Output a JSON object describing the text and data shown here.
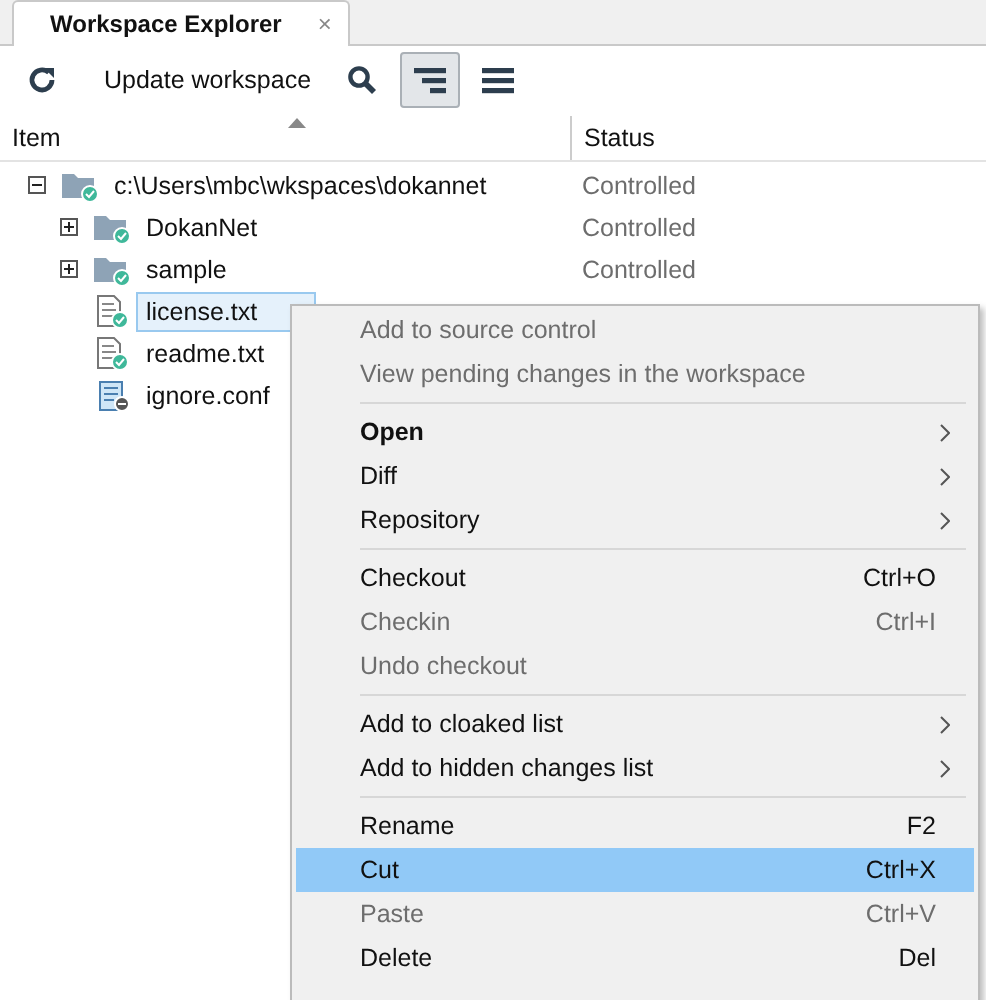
{
  "tabs": [
    {
      "label": "Workspace Explorer",
      "close": "×",
      "selected": true
    }
  ],
  "toolbar": {
    "items": [
      {
        "kind": "refresh",
        "selected": false
      },
      {
        "kind": "label",
        "label": "Update workspace"
      },
      {
        "kind": "search",
        "selected": false
      },
      {
        "kind": "filter",
        "selected": true
      },
      {
        "kind": "menu",
        "selected": false
      }
    ]
  },
  "table": {
    "columns": [
      {
        "label": "Item",
        "sorted": true
      },
      {
        "label": "Status"
      }
    ],
    "rows": [
      {
        "name": "c:\\Users\\mbc\\wkspaces\\dokannet",
        "kind": "folder",
        "status": "Controlled",
        "expanded": true,
        "selected": false,
        "children": [
          {
            "name": "DokanNet",
            "kind": "folder",
            "status": "Controlled",
            "expanded": false,
            "selected": false
          },
          {
            "name": "sample",
            "kind": "folder",
            "status": "Controlled",
            "expanded": false,
            "selected": false
          },
          {
            "name": "license.txt",
            "kind": "file",
            "selected": true
          },
          {
            "name": "readme.txt",
            "kind": "file",
            "selected": false
          },
          {
            "name": "ignore.conf",
            "kind": "config",
            "selected": false
          }
        ]
      }
    ]
  },
  "context_menu": {
    "items": [
      {
        "kind": "item",
        "label": "Add to source control",
        "disabled": true,
        "bold": false,
        "submenu": false,
        "selected": false
      },
      {
        "kind": "item",
        "label": "View pending changes in the workspace",
        "disabled": true,
        "bold": false,
        "submenu": false,
        "selected": false
      },
      {
        "kind": "separator"
      },
      {
        "kind": "item",
        "label": "Open",
        "disabled": false,
        "bold": true,
        "submenu": true,
        "selected": false
      },
      {
        "kind": "item",
        "label": "Diff",
        "disabled": false,
        "bold": false,
        "submenu": true,
        "selected": false
      },
      {
        "kind": "item",
        "label": "Repository",
        "disabled": false,
        "bold": false,
        "submenu": true,
        "selected": false
      },
      {
        "kind": "separator"
      },
      {
        "kind": "item",
        "label": "Checkout",
        "shortcut": "Ctrl+O",
        "disabled": false,
        "bold": false,
        "submenu": false,
        "selected": false
      },
      {
        "kind": "item",
        "label": "Checkin",
        "shortcut": "Ctrl+I",
        "disabled": true,
        "bold": false,
        "submenu": false,
        "selected": false
      },
      {
        "kind": "item",
        "label": "Undo checkout",
        "disabled": true,
        "bold": false,
        "submenu": false,
        "selected": false
      },
      {
        "kind": "separator"
      },
      {
        "kind": "item",
        "label": "Add to cloaked list",
        "disabled": false,
        "bold": false,
        "submenu": true,
        "selected": false
      },
      {
        "kind": "item",
        "label": "Add to hidden changes list",
        "disabled": false,
        "bold": false,
        "submenu": true,
        "selected": false
      },
      {
        "kind": "separator"
      },
      {
        "kind": "item",
        "label": "Rename",
        "shortcut": "F2",
        "disabled": false,
        "bold": false,
        "submenu": false,
        "selected": false
      },
      {
        "kind": "item",
        "label": "Cut",
        "shortcut": "Ctrl+X",
        "disabled": false,
        "bold": false,
        "submenu": false,
        "selected": true
      },
      {
        "kind": "item",
        "label": "Paste",
        "shortcut": "Ctrl+V",
        "disabled": true,
        "bold": false,
        "submenu": false,
        "selected": false
      },
      {
        "kind": "item",
        "label": "Delete",
        "shortcut": "Del",
        "disabled": false,
        "bold": false,
        "submenu": false,
        "selected": false
      }
    ]
  }
}
